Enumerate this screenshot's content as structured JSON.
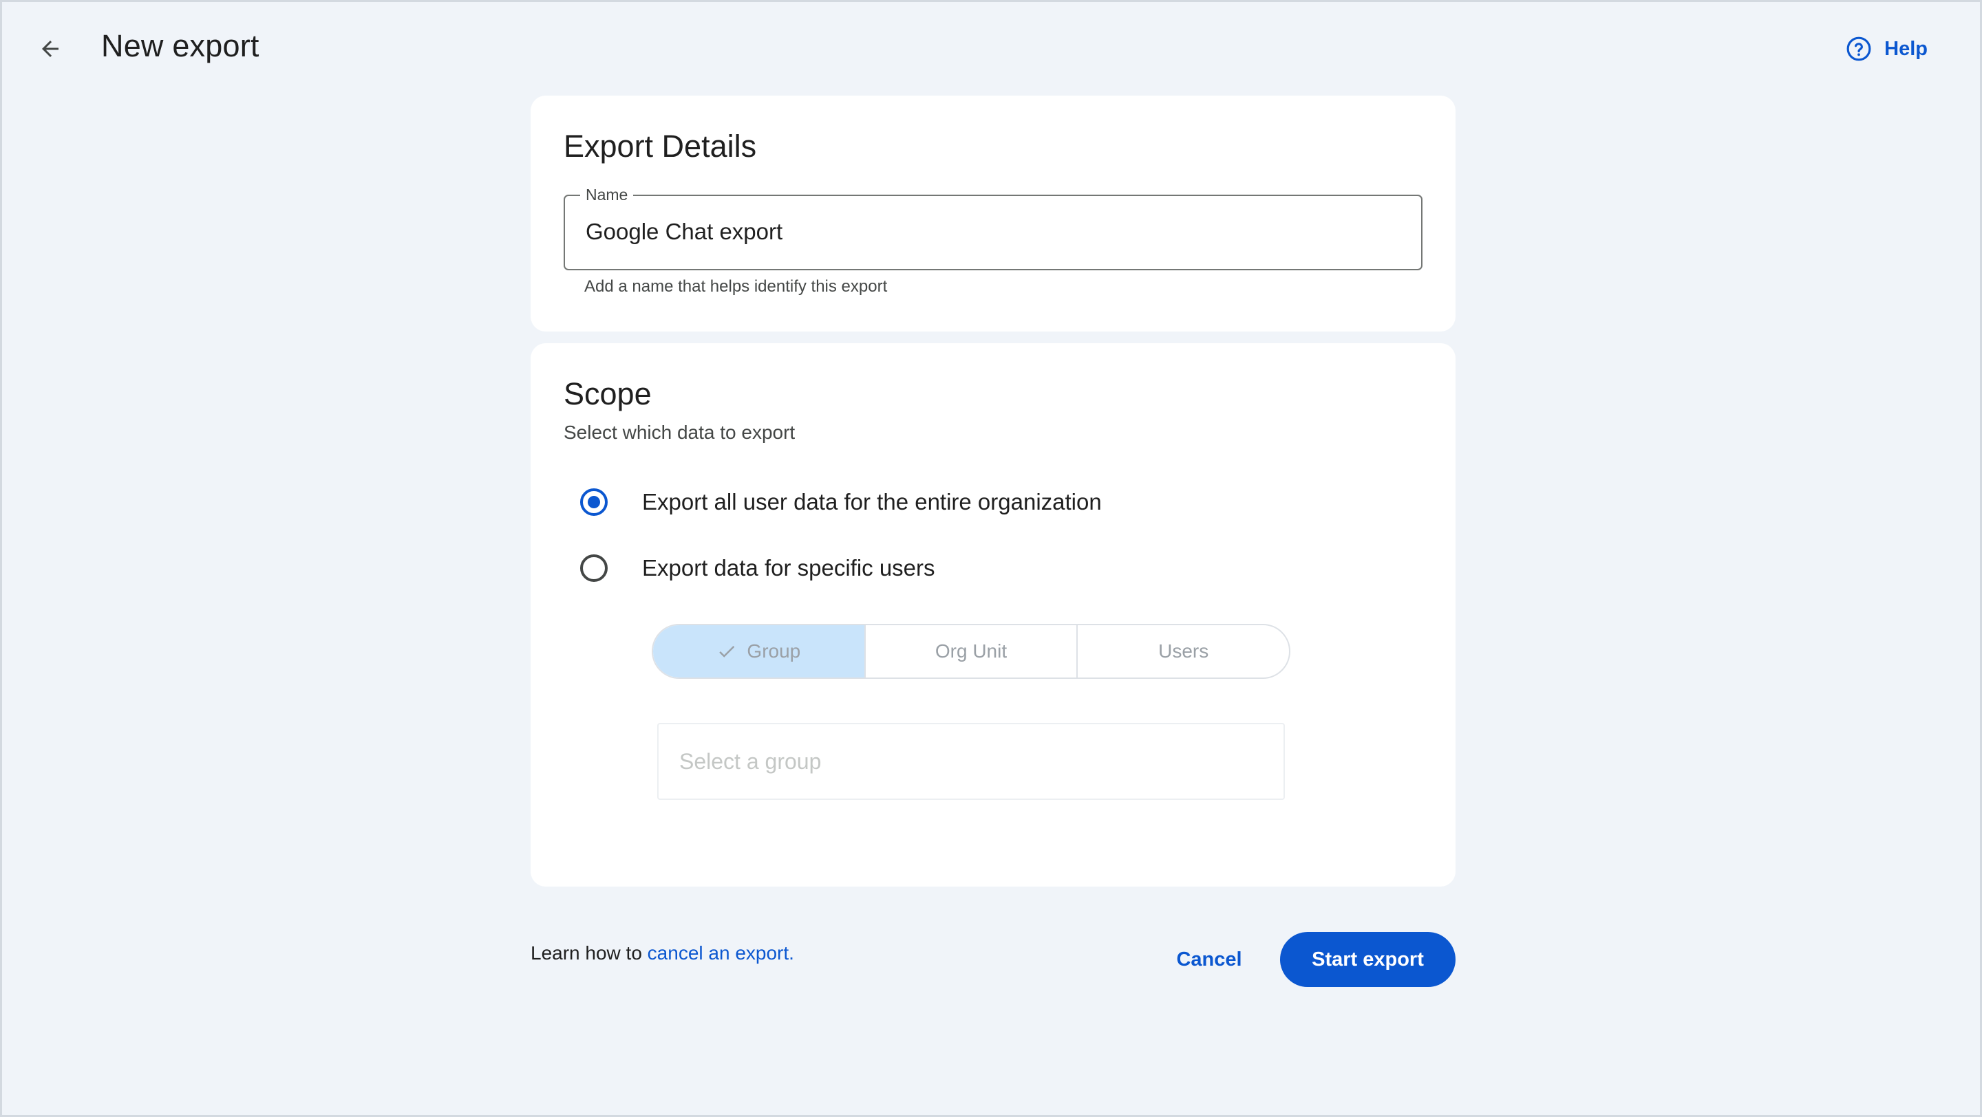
{
  "header": {
    "back_icon": "arrow-back-icon",
    "title": "New export",
    "help_icon": "help-circle-icon",
    "help_label": "Help"
  },
  "details": {
    "title": "Export Details",
    "name_label": "Name",
    "name_value": "Google Chat export",
    "name_help": "Add a name that helps identify this export"
  },
  "scope": {
    "title": "Scope",
    "subtitle": "Select which data to export",
    "options": [
      {
        "label": "Export all user data for the entire organization",
        "checked": true
      },
      {
        "label": "Export data for specific users",
        "checked": false
      }
    ],
    "segments": [
      {
        "label": "Group",
        "selected": true
      },
      {
        "label": "Org Unit",
        "selected": false
      },
      {
        "label": "Users",
        "selected": false
      }
    ],
    "group_placeholder": "Select a group"
  },
  "footer": {
    "learn_prefix": "Learn how to ",
    "learn_link": "cancel an export.",
    "cancel_label": "Cancel",
    "start_label": "Start export"
  },
  "colors": {
    "accent": "#0b57d0",
    "background": "#f0f4f9",
    "segment_selected": "#c9e4fb"
  }
}
